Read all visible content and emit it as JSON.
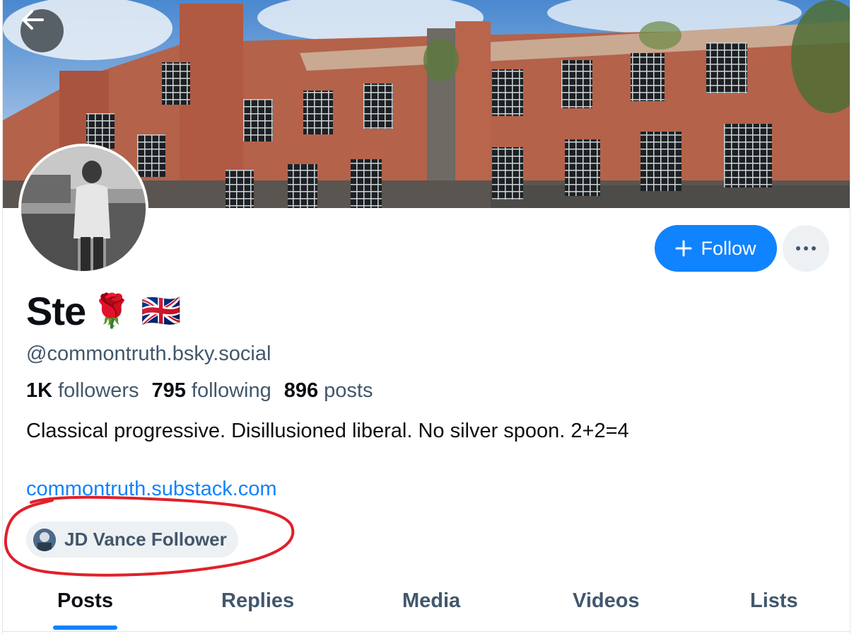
{
  "profile": {
    "display_name": "Ste",
    "name_emojis": "🌹 🇬🇧",
    "handle": "@commontruth.bsky.social",
    "stats": {
      "followers_count": "1K",
      "followers_label": "followers",
      "following_count": "795",
      "following_label": "following",
      "posts_count": "896",
      "posts_label": "posts"
    },
    "bio": "Classical progressive. Disillusioned liberal. No silver spoon. 2+2=4",
    "link": "commontruth.substack.com",
    "badge": "JD Vance Follower"
  },
  "actions": {
    "follow_label": "Follow"
  },
  "tabs": [
    {
      "label": "Posts",
      "active": true
    },
    {
      "label": "Replies",
      "active": false
    },
    {
      "label": "Media",
      "active": false
    },
    {
      "label": "Videos",
      "active": false
    },
    {
      "label": "Lists",
      "active": false
    }
  ],
  "colors": {
    "accent": "#1083fe",
    "muted_text": "#42576c",
    "annotation": "#e0202a"
  },
  "icons": [
    "back-arrow-icon",
    "plus-icon",
    "more-dots-icon"
  ]
}
